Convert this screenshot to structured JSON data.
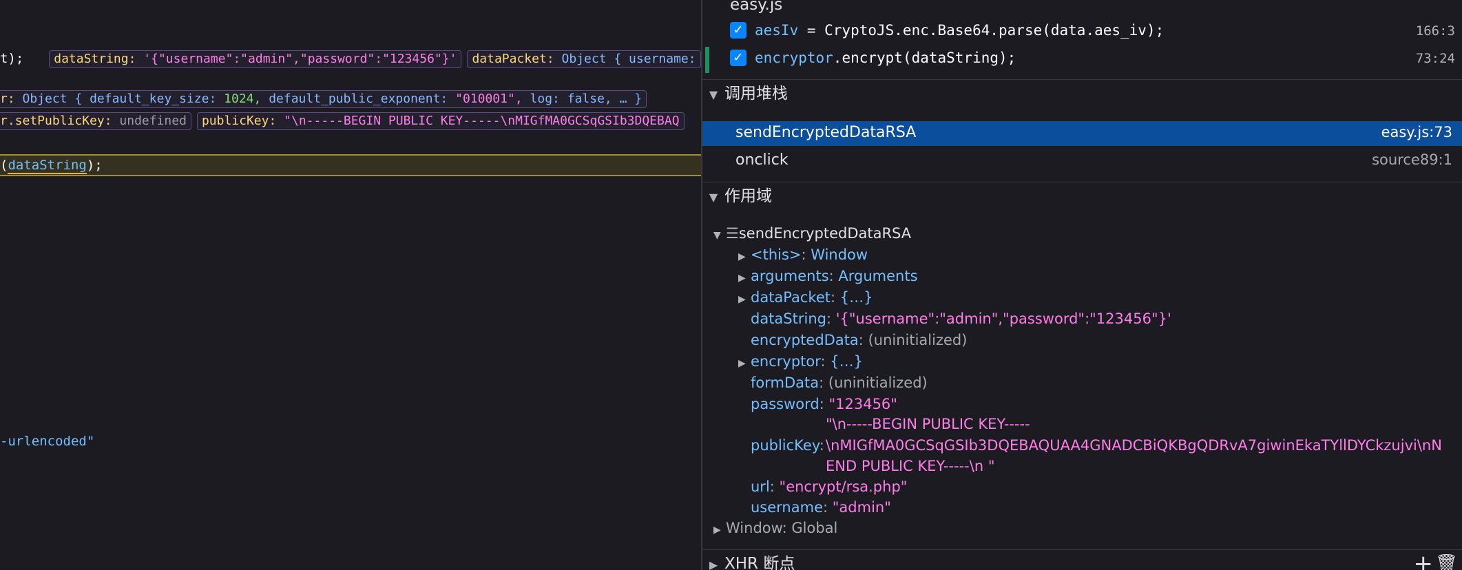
{
  "editor": {
    "line1": {
      "prefix": "t);",
      "badges": [
        {
          "name": "dataString:",
          "value": "'{\"username\":\"admin\",\"password\":\"123456\"}'"
        },
        {
          "name": "dataPacket:",
          "value": "Object { username:"
        }
      ]
    },
    "line2": {
      "name": "r:",
      "obj_open": "Object {",
      "k1": "default_key_size:",
      "v1": "1024,",
      "k2": "default_public_exponent:",
      "v2": "\"010001\",",
      "k3": "log:",
      "v3": "false, … }"
    },
    "line3": {
      "badges": [
        {
          "name": "r.setPublicKey:",
          "value": "undefined"
        },
        {
          "name": "publicKey:",
          "value": "\"\\n-----BEGIN PUBLIC KEY-----\\nMIGfMA0GCSqGSIb3DQEBAQ"
        }
      ]
    },
    "paused_line": {
      "open": "(",
      "var": "dataString",
      "close": ");"
    },
    "line4": "-urlencoded\""
  },
  "debugger": {
    "file_title": "easy.js",
    "breakpoints": [
      {
        "code_var": "aesIv",
        "code_rest": " = CryptoJS.enc.Base64.parse(data.aes_iv);",
        "location": "166:3"
      },
      {
        "code_var": "encryptor",
        "code_rest": ".encrypt(dataString);",
        "location": "73:24"
      }
    ],
    "call_stack": {
      "title": "调用堆栈",
      "frames": [
        {
          "name": "sendEncryptedDataRSA",
          "location": "easy.js:73",
          "selected": true
        },
        {
          "name": "onclick",
          "location": "source89:1",
          "selected": false
        }
      ]
    },
    "scopes": {
      "title": "作用域",
      "block_name": "sendEncryptedDataRSA",
      "items": [
        {
          "key": "<this>",
          "value": "Window",
          "expandable": true,
          "kind": "obj"
        },
        {
          "key": "arguments",
          "value": "Arguments",
          "expandable": true,
          "kind": "obj"
        },
        {
          "key": "dataPacket",
          "value": "{…}",
          "expandable": true,
          "kind": "obj"
        },
        {
          "key": "dataString",
          "value": "'{\"username\":\"admin\",\"password\":\"123456\"}'",
          "expandable": false,
          "kind": "str"
        },
        {
          "key": "encryptedData",
          "value": "(uninitialized)",
          "expandable": false,
          "kind": "dim"
        },
        {
          "key": "encryptor",
          "value": "{…}",
          "expandable": true,
          "kind": "obj"
        },
        {
          "key": "formData",
          "value": "(uninitialized)",
          "expandable": false,
          "kind": "dim"
        },
        {
          "key": "password",
          "value": "\"123456\"",
          "expandable": false,
          "kind": "str"
        }
      ],
      "public_key": {
        "key": "publicKey",
        "line1": "\"\\n-----BEGIN PUBLIC KEY-----",
        "line2": "\\nMIGfMA0GCSqGSIb3DQEBAQUAA4GNADCBiQKBgQDRvA7giwinEkaTYllDYCkzujvi\\nN",
        "line3": "END PUBLIC KEY-----\\n  \""
      },
      "tail_items": [
        {
          "key": "url",
          "value": "\"encrypt/rsa.php\""
        },
        {
          "key": "username",
          "value": "\"admin\""
        }
      ],
      "window_global": "Window: Global"
    },
    "xhr_breakpoints": {
      "title": "XHR 断点"
    }
  }
}
